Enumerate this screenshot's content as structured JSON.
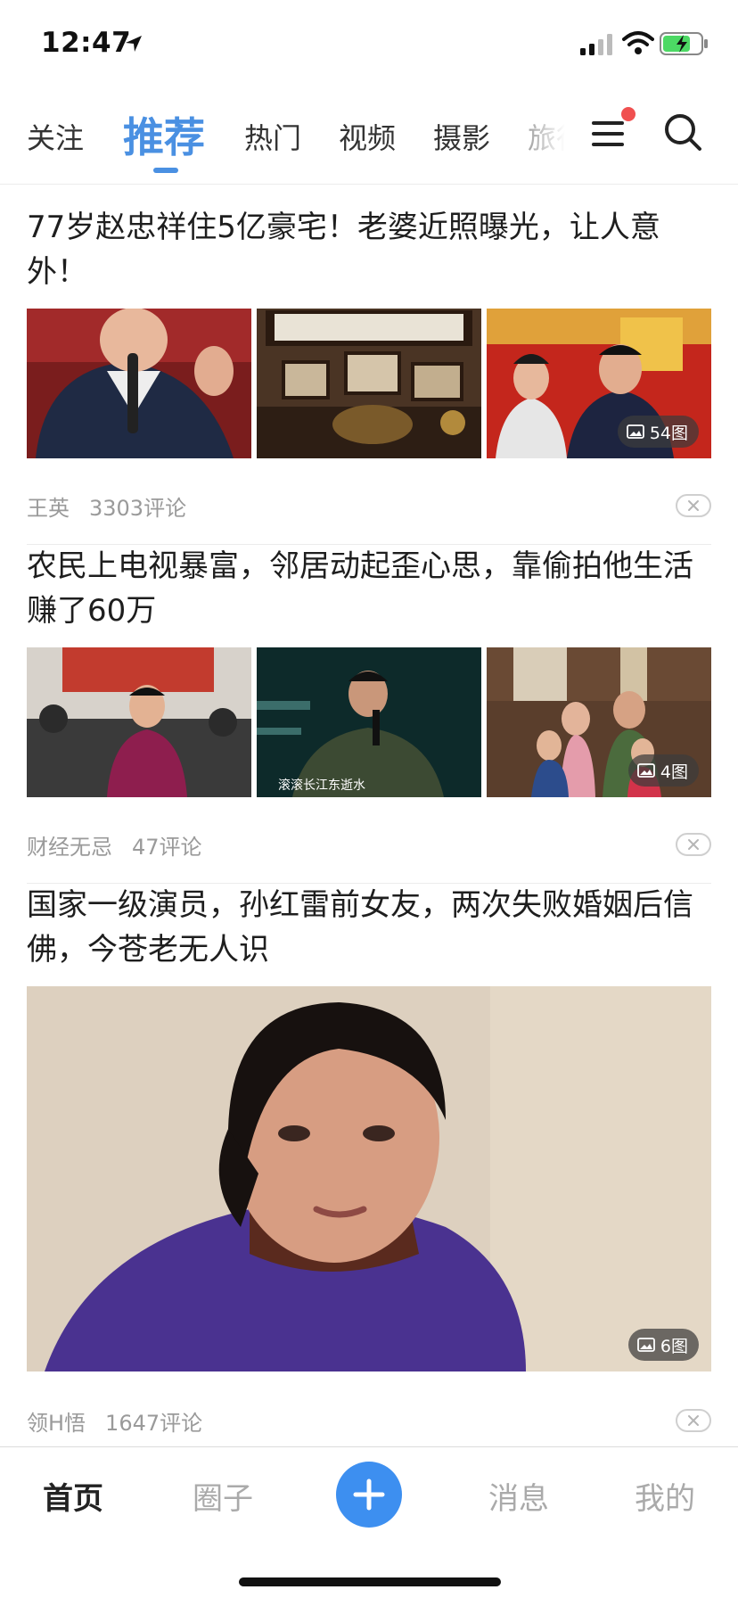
{
  "status_bar": {
    "time": "12:47"
  },
  "top_tabs": [
    {
      "label": "关注",
      "active": false
    },
    {
      "label": "推荐",
      "active": true
    },
    {
      "label": "热门",
      "active": false
    },
    {
      "label": "视频",
      "active": false
    },
    {
      "label": "摄影",
      "active": false
    },
    {
      "label": "旅行",
      "active": false
    }
  ],
  "articles": [
    {
      "title": "77岁赵忠祥住5亿豪宅！老婆近照曝光，让人意外！",
      "images": [
        "man-with-microphone",
        "living-room-shelf",
        "host-duo-on-stage"
      ],
      "photo_count": "54图",
      "author": "王英",
      "comments": "3303评论"
    },
    {
      "title": "农民上电视暴富，邻居动起歪心思，靠偷拍他生活赚了60万",
      "images": [
        "man-in-purple-jacket-crowd",
        "man-singing-on-tv",
        "family-at-door"
      ],
      "image_captions": [
        "",
        "滚滚长江东逝水",
        ""
      ],
      "photo_count": "4图",
      "author": "财经无忌",
      "comments": "47评论"
    },
    {
      "title": "国家一级演员，孙红雷前女友，两次失败婚姻后信佛，今苍老无人识",
      "images": [
        "woman-portrait"
      ],
      "photo_count": "6图",
      "author": "领H悟",
      "comments": "1647评论"
    }
  ],
  "bottom_nav": {
    "home": "首页",
    "circle": "圈子",
    "messages": "消息",
    "mine": "我的"
  },
  "colors": {
    "accent": "#4a90e2",
    "plus_button": "#3d8ff0",
    "badge_dot": "#f05050",
    "meta_text": "#9a9a9a"
  }
}
